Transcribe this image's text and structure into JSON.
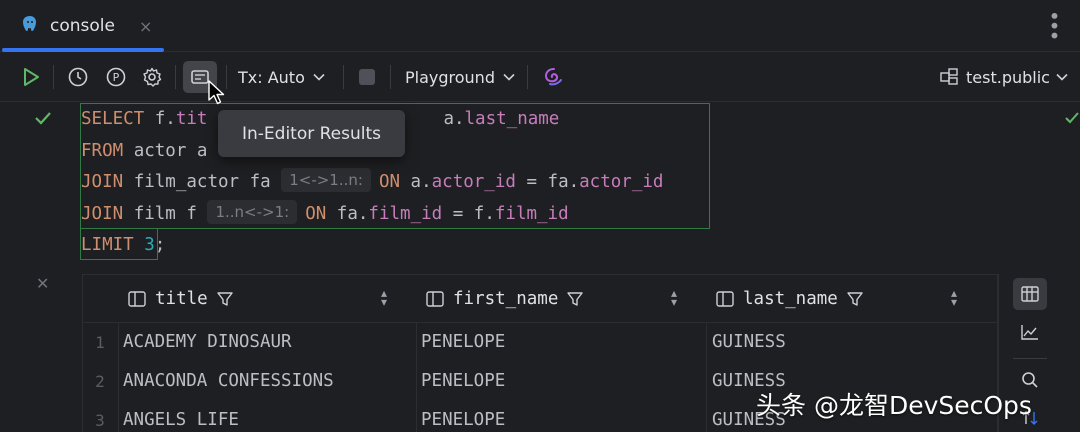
{
  "tab": {
    "label": "console",
    "close": "×"
  },
  "toolbar": {
    "tx_label": "Tx: Auto",
    "playground_label": "Playground",
    "schema_label": "test.public"
  },
  "tooltip": {
    "text": "In-Editor Results"
  },
  "editor": {
    "lines": [
      {
        "kw": "SELECT",
        "a": " f.",
        "b": "tit",
        "c": "",
        "d": "a.",
        "e": "last_name"
      },
      {
        "kw": "FROM",
        "a": " actor a"
      },
      {
        "kw": "JOIN",
        "a": " film_actor fa ",
        "hint": "1<->1..n:",
        "kw2": "ON",
        "b": " a.",
        "col1": "actor_id",
        "c": " = fa.",
        "col2": "actor_id"
      },
      {
        "kw": "JOIN",
        "a": " film f ",
        "hint": "1..n<->1:",
        "kw2": "ON",
        "b": " fa.",
        "col1": "film_id",
        "c": " = f.",
        "col2": "film_id"
      },
      {
        "kw": "LIMIT",
        "num": "3",
        "semi": ";"
      }
    ]
  },
  "results": {
    "columns": [
      "title",
      "first_name",
      "last_name"
    ],
    "rows": [
      {
        "n": "1",
        "title": "ACADEMY DINOSAUR",
        "first_name": "PENELOPE",
        "last_name": "GUINESS"
      },
      {
        "n": "2",
        "title": "ANACONDA CONFESSIONS",
        "first_name": "PENELOPE",
        "last_name": "GUINESS"
      },
      {
        "n": "3",
        "title": "ANGELS LIFE",
        "first_name": "PENELOPE",
        "last_name": "GUINESS"
      }
    ]
  },
  "watermark": "头条 @龙智DevSecOps",
  "colors": {
    "accent": "#3574f0",
    "keyword": "#cf8e6d",
    "column": "#c77dbb",
    "number": "#2aacb8",
    "run_green": "#5fb865"
  }
}
